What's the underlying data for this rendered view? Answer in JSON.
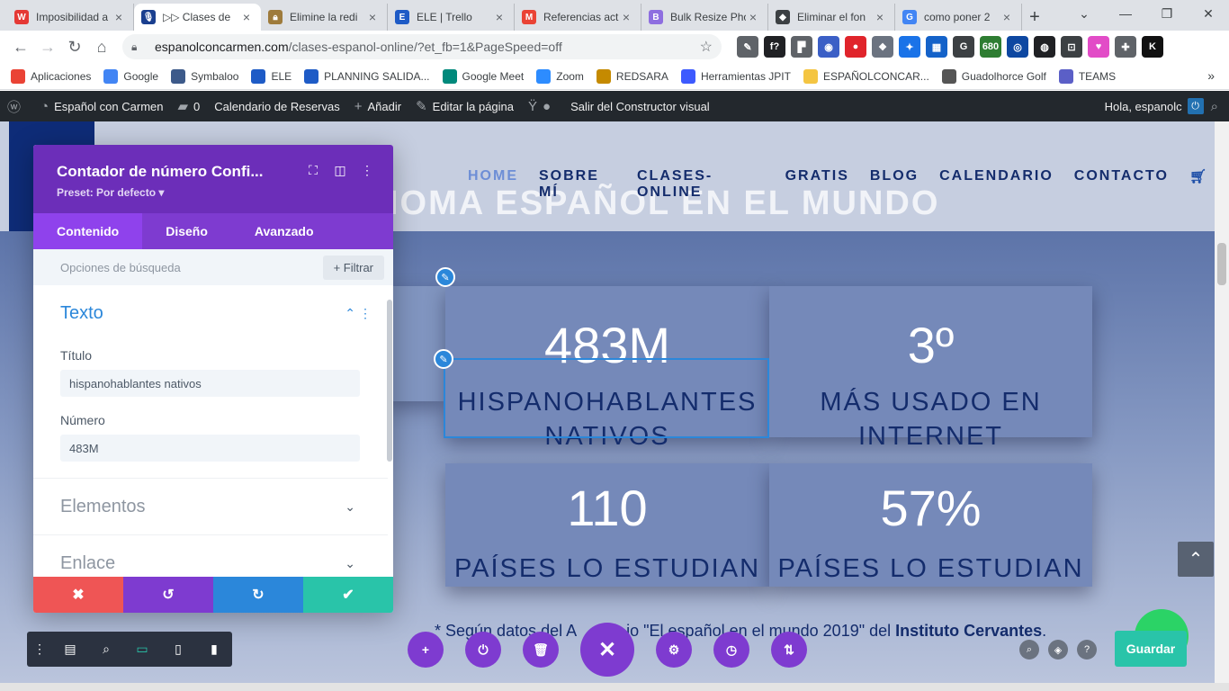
{
  "browser": {
    "tabs": [
      {
        "title": "Imposibilidad a",
        "icon": "w",
        "color": "#e53935"
      },
      {
        "title": "▷▷ Clases de",
        "icon": "mic",
        "color": "#1a3f8f",
        "active": true
      },
      {
        "title": "Elimine la redi",
        "icon": "lock",
        "color": "#9e7b3c"
      },
      {
        "title": "ELE | Trello",
        "icon": "E",
        "color": "#1e5bc6"
      },
      {
        "title": "Referencias act",
        "icon": "M",
        "color": "#ea4335"
      },
      {
        "title": "Bulk Resize Pho",
        "icon": "B",
        "color": "#8e6ee0"
      },
      {
        "title": "Eliminar el fon",
        "icon": "mortar",
        "color": "#3c4043"
      },
      {
        "title": "como poner 2",
        "icon": "G",
        "color": "#4285f4"
      }
    ],
    "new_tab": "+",
    "url_host": "espanolconcarmen.com",
    "url_path": "/clases-espanol-online/?et_fb=1&PageSpeed=off",
    "extensions": [
      {
        "label": "✎",
        "color": "#5f6368"
      },
      {
        "label": "f?",
        "color": "#202124"
      },
      {
        "label": "▛",
        "color": "#5f6368"
      },
      {
        "label": "◉",
        "color": "#3b5fc6"
      },
      {
        "label": "●",
        "color": "#e0242b"
      },
      {
        "label": "❖",
        "color": "#6b7380"
      },
      {
        "label": "✦",
        "color": "#1a73e8"
      },
      {
        "label": "▦",
        "color": "#1462c9"
      },
      {
        "label": "G",
        "color": "#3c4043"
      },
      {
        "label": "680",
        "color": "#2e7d32"
      },
      {
        "label": "◎",
        "color": "#0d47a1"
      },
      {
        "label": "◍",
        "color": "#202124"
      },
      {
        "label": "⊡",
        "color": "#3c4043"
      },
      {
        "label": "♥",
        "color": "#e24cc7"
      },
      {
        "label": "✚",
        "color": "#5f6368"
      },
      {
        "label": "K",
        "color": "#111"
      }
    ],
    "bookmarks": [
      {
        "label": "Aplicaciones",
        "color": "#ea4335"
      },
      {
        "label": "Google",
        "color": "#4285f4"
      },
      {
        "label": "Symbaloo",
        "color": "#3d5a8a"
      },
      {
        "label": "ELE",
        "color": "#1e5bc6"
      },
      {
        "label": "PLANNING SALIDA...",
        "color": "#1e5bc6"
      },
      {
        "label": "Google Meet",
        "color": "#00897b"
      },
      {
        "label": "Zoom",
        "color": "#2d8cff"
      },
      {
        "label": "REDSARA",
        "color": "#c58a00"
      },
      {
        "label": "Herramientas JPIT",
        "color": "#3d5afe"
      },
      {
        "label": "ESPAÑOLCONCAR...",
        "color": "#f4c542"
      },
      {
        "label": "Guadolhorce Golf",
        "color": "#555"
      },
      {
        "label": "TEAMS",
        "color": "#5b5fc7"
      }
    ]
  },
  "wp": {
    "site_name": "Español con Carmen",
    "comments": "0",
    "items": [
      "Calendario de Reservas",
      "Añadir",
      "Editar la página",
      "Salir del Constructor visual"
    ],
    "greeting": "Hola, espanolc"
  },
  "site": {
    "nav": [
      "HOME",
      "SOBRE MÍ",
      "CLASES-ONLINE",
      "GRATIS",
      "BLOG",
      "CALENDARIO",
      "CONTACTO"
    ],
    "hero_title": "IOMA ESPAÑOL EN EL MUNDO",
    "counters": [
      {
        "number": "483M",
        "label": "HISPANOHABLANTES NATIVOS"
      },
      {
        "number": "3º",
        "label": "MÁS USADO EN INTERNET"
      },
      {
        "number": "110",
        "label": "PAÍSES LO ESTUDIAN"
      },
      {
        "number": "57%",
        "label": "PAÍSES LO ESTUDIAN"
      }
    ],
    "footnote_pre": "* Según datos del A",
    "footnote_mid": "io \"El español en el mundo 2019\" del ",
    "footnote_bold": "Instituto Cervantes",
    "footnote_end": "."
  },
  "panel": {
    "title": "Contador de número Confi...",
    "preset": "Preset: Por defecto ▾",
    "tabs": [
      "Contenido",
      "Diseño",
      "Avanzado"
    ],
    "search_placeholder": "Opciones de búsqueda",
    "filter": "+ Filtrar",
    "section_texto": "Texto",
    "field_title_label": "Título",
    "field_title_value": "hispanohablantes nativos",
    "field_number_label": "Número",
    "field_number_value": "483M",
    "section_elementos": "Elementos",
    "section_enlace": "Enlace"
  },
  "builder": {
    "save": "Guardar"
  }
}
